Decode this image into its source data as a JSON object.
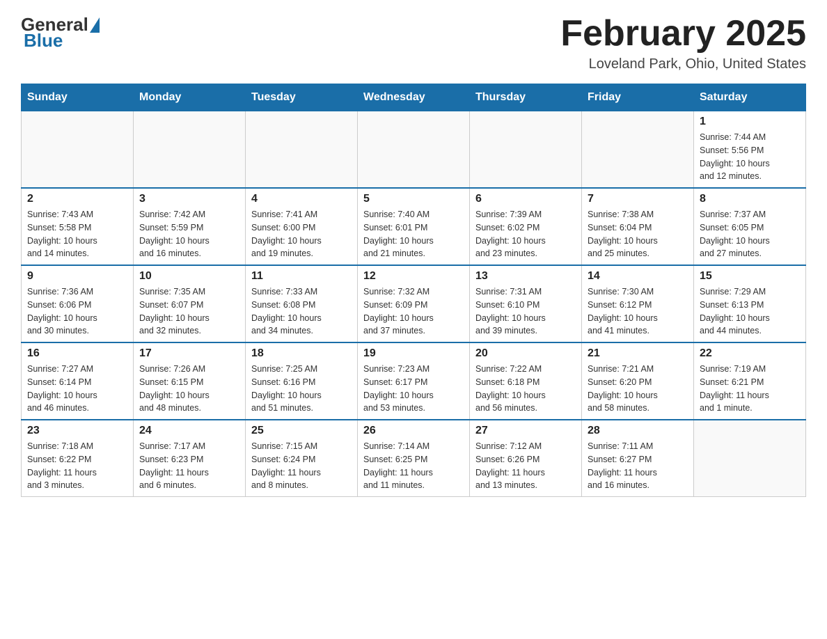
{
  "header": {
    "logo_general": "General",
    "logo_blue": "Blue",
    "month_title": "February 2025",
    "location": "Loveland Park, Ohio, United States"
  },
  "days_of_week": [
    "Sunday",
    "Monday",
    "Tuesday",
    "Wednesday",
    "Thursday",
    "Friday",
    "Saturday"
  ],
  "weeks": [
    {
      "days": [
        {
          "num": "",
          "info": ""
        },
        {
          "num": "",
          "info": ""
        },
        {
          "num": "",
          "info": ""
        },
        {
          "num": "",
          "info": ""
        },
        {
          "num": "",
          "info": ""
        },
        {
          "num": "",
          "info": ""
        },
        {
          "num": "1",
          "info": "Sunrise: 7:44 AM\nSunset: 5:56 PM\nDaylight: 10 hours\nand 12 minutes."
        }
      ]
    },
    {
      "days": [
        {
          "num": "2",
          "info": "Sunrise: 7:43 AM\nSunset: 5:58 PM\nDaylight: 10 hours\nand 14 minutes."
        },
        {
          "num": "3",
          "info": "Sunrise: 7:42 AM\nSunset: 5:59 PM\nDaylight: 10 hours\nand 16 minutes."
        },
        {
          "num": "4",
          "info": "Sunrise: 7:41 AM\nSunset: 6:00 PM\nDaylight: 10 hours\nand 19 minutes."
        },
        {
          "num": "5",
          "info": "Sunrise: 7:40 AM\nSunset: 6:01 PM\nDaylight: 10 hours\nand 21 minutes."
        },
        {
          "num": "6",
          "info": "Sunrise: 7:39 AM\nSunset: 6:02 PM\nDaylight: 10 hours\nand 23 minutes."
        },
        {
          "num": "7",
          "info": "Sunrise: 7:38 AM\nSunset: 6:04 PM\nDaylight: 10 hours\nand 25 minutes."
        },
        {
          "num": "8",
          "info": "Sunrise: 7:37 AM\nSunset: 6:05 PM\nDaylight: 10 hours\nand 27 minutes."
        }
      ]
    },
    {
      "days": [
        {
          "num": "9",
          "info": "Sunrise: 7:36 AM\nSunset: 6:06 PM\nDaylight: 10 hours\nand 30 minutes."
        },
        {
          "num": "10",
          "info": "Sunrise: 7:35 AM\nSunset: 6:07 PM\nDaylight: 10 hours\nand 32 minutes."
        },
        {
          "num": "11",
          "info": "Sunrise: 7:33 AM\nSunset: 6:08 PM\nDaylight: 10 hours\nand 34 minutes."
        },
        {
          "num": "12",
          "info": "Sunrise: 7:32 AM\nSunset: 6:09 PM\nDaylight: 10 hours\nand 37 minutes."
        },
        {
          "num": "13",
          "info": "Sunrise: 7:31 AM\nSunset: 6:10 PM\nDaylight: 10 hours\nand 39 minutes."
        },
        {
          "num": "14",
          "info": "Sunrise: 7:30 AM\nSunset: 6:12 PM\nDaylight: 10 hours\nand 41 minutes."
        },
        {
          "num": "15",
          "info": "Sunrise: 7:29 AM\nSunset: 6:13 PM\nDaylight: 10 hours\nand 44 minutes."
        }
      ]
    },
    {
      "days": [
        {
          "num": "16",
          "info": "Sunrise: 7:27 AM\nSunset: 6:14 PM\nDaylight: 10 hours\nand 46 minutes."
        },
        {
          "num": "17",
          "info": "Sunrise: 7:26 AM\nSunset: 6:15 PM\nDaylight: 10 hours\nand 48 minutes."
        },
        {
          "num": "18",
          "info": "Sunrise: 7:25 AM\nSunset: 6:16 PM\nDaylight: 10 hours\nand 51 minutes."
        },
        {
          "num": "19",
          "info": "Sunrise: 7:23 AM\nSunset: 6:17 PM\nDaylight: 10 hours\nand 53 minutes."
        },
        {
          "num": "20",
          "info": "Sunrise: 7:22 AM\nSunset: 6:18 PM\nDaylight: 10 hours\nand 56 minutes."
        },
        {
          "num": "21",
          "info": "Sunrise: 7:21 AM\nSunset: 6:20 PM\nDaylight: 10 hours\nand 58 minutes."
        },
        {
          "num": "22",
          "info": "Sunrise: 7:19 AM\nSunset: 6:21 PM\nDaylight: 11 hours\nand 1 minute."
        }
      ]
    },
    {
      "days": [
        {
          "num": "23",
          "info": "Sunrise: 7:18 AM\nSunset: 6:22 PM\nDaylight: 11 hours\nand 3 minutes."
        },
        {
          "num": "24",
          "info": "Sunrise: 7:17 AM\nSunset: 6:23 PM\nDaylight: 11 hours\nand 6 minutes."
        },
        {
          "num": "25",
          "info": "Sunrise: 7:15 AM\nSunset: 6:24 PM\nDaylight: 11 hours\nand 8 minutes."
        },
        {
          "num": "26",
          "info": "Sunrise: 7:14 AM\nSunset: 6:25 PM\nDaylight: 11 hours\nand 11 minutes."
        },
        {
          "num": "27",
          "info": "Sunrise: 7:12 AM\nSunset: 6:26 PM\nDaylight: 11 hours\nand 13 minutes."
        },
        {
          "num": "28",
          "info": "Sunrise: 7:11 AM\nSunset: 6:27 PM\nDaylight: 11 hours\nand 16 minutes."
        },
        {
          "num": "",
          "info": ""
        }
      ]
    }
  ]
}
